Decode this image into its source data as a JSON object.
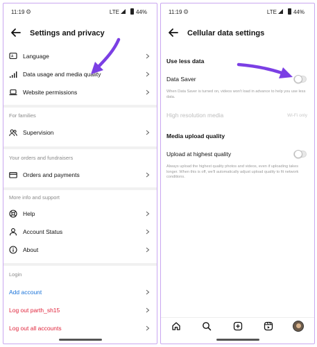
{
  "left": {
    "status": {
      "time": "11:19",
      "network": "LTE",
      "battery": "44%"
    },
    "header": {
      "title": "Settings and privacy"
    },
    "items_top": [
      {
        "label": "Language",
        "icon": "language-icon"
      },
      {
        "label": "Data usage and media quality",
        "icon": "signal-bars-icon"
      },
      {
        "label": "Website permissions",
        "icon": "laptop-icon"
      }
    ],
    "families": {
      "section": "For families",
      "items": [
        {
          "label": "Supervision",
          "icon": "people-icon"
        }
      ]
    },
    "orders": {
      "section": "Your orders and fundraisers",
      "items": [
        {
          "label": "Orders and payments",
          "icon": "card-icon"
        }
      ]
    },
    "more_info": {
      "section": "More info and support",
      "items": [
        {
          "label": "Help",
          "icon": "lifebuoy-icon"
        },
        {
          "label": "Account Status",
          "icon": "person-icon"
        },
        {
          "label": "About",
          "icon": "info-icon"
        }
      ]
    },
    "login": {
      "section": "Login",
      "add_account": "Add account",
      "log_out_user": "Log out parth_sh15",
      "log_out_all": "Log out all accounts"
    }
  },
  "right": {
    "status": {
      "time": "11:19",
      "network": "LTE",
      "battery": "44%"
    },
    "header": {
      "title": "Cellular data settings"
    },
    "use_less_data": {
      "heading": "Use less data",
      "data_saver_label": "Data Saver",
      "data_saver_on": false,
      "data_saver_desc": "When Data Saver is turned on, videos won't load in advance to help you use less data.",
      "high_res_label": "High resolution media",
      "high_res_value": "Wi-Fi only"
    },
    "media_upload": {
      "heading": "Media upload quality",
      "upload_label": "Upload at highest quality",
      "upload_on": false,
      "upload_desc": "Always upload the highest quality photos and videos, even if uploading takes longer. When this is off, we'll automatically adjust upload quality to fit network conditions."
    },
    "bottom_nav": [
      "home-icon",
      "search-icon",
      "create-icon",
      "reels-icon",
      "profile-avatar"
    ]
  },
  "colors": {
    "accent_arrow": "#7b3fe4",
    "link_blue": "#1a73d9",
    "danger_red": "#e0243b",
    "frame": "#c9a6f0"
  }
}
